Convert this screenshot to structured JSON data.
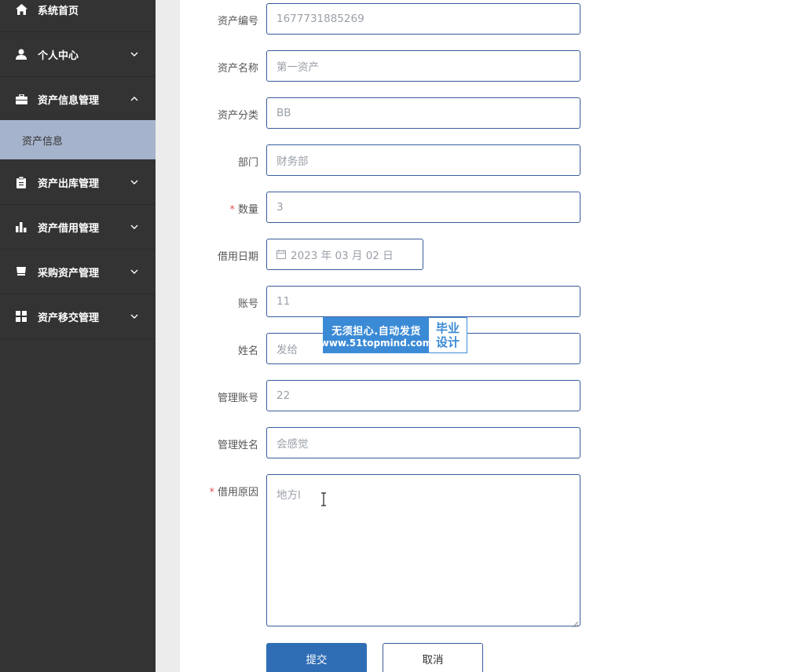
{
  "sidebar": {
    "items": [
      {
        "label": "系统首页",
        "icon": "home-icon"
      },
      {
        "label": "个人中心",
        "icon": "user-icon"
      },
      {
        "label": "资产信息管理",
        "icon": "briefcase-icon"
      },
      {
        "label": "资产出库管理",
        "icon": "clipboard-icon"
      },
      {
        "label": "资产借用管理",
        "icon": "bar-chart-icon"
      },
      {
        "label": "采购资产管理",
        "icon": "cart-icon"
      },
      {
        "label": "资产移交管理",
        "icon": "grid-icon"
      }
    ],
    "submenu": {
      "label": "资产信息"
    }
  },
  "form": {
    "asset_code": {
      "label": "资产编号",
      "value": "1677731885269"
    },
    "asset_name": {
      "label": "资产名称",
      "value": "第一资产"
    },
    "asset_category": {
      "label": "资产分类",
      "value": "BB"
    },
    "department": {
      "label": "部门",
      "value": "财务部"
    },
    "quantity": {
      "label": "数量",
      "value": "3",
      "required": "*"
    },
    "borrow_date": {
      "label": "借用日期",
      "value": "2023 年 03 月 02 日"
    },
    "account": {
      "label": "账号",
      "value": "11"
    },
    "name": {
      "label": "姓名",
      "value": "发给"
    },
    "admin_account": {
      "label": "管理账号",
      "value": "22"
    },
    "admin_name": {
      "label": "管理姓名",
      "value": "会感觉"
    },
    "borrow_reason": {
      "label": "借用原因",
      "value": "地方l",
      "required": "*"
    }
  },
  "buttons": {
    "submit": "提交",
    "cancel": "取消"
  },
  "watermark": {
    "line1": "无须担心.自动发货",
    "line2": "www.51topmind.com",
    "right1": "毕业",
    "right2": "设计"
  },
  "colors": {
    "sidebar_bg": "#333333",
    "submenu_active": "#a6b3cc",
    "primary": "#2f6eb5",
    "input_border": "#3a5c9c",
    "required": "#e05252"
  }
}
